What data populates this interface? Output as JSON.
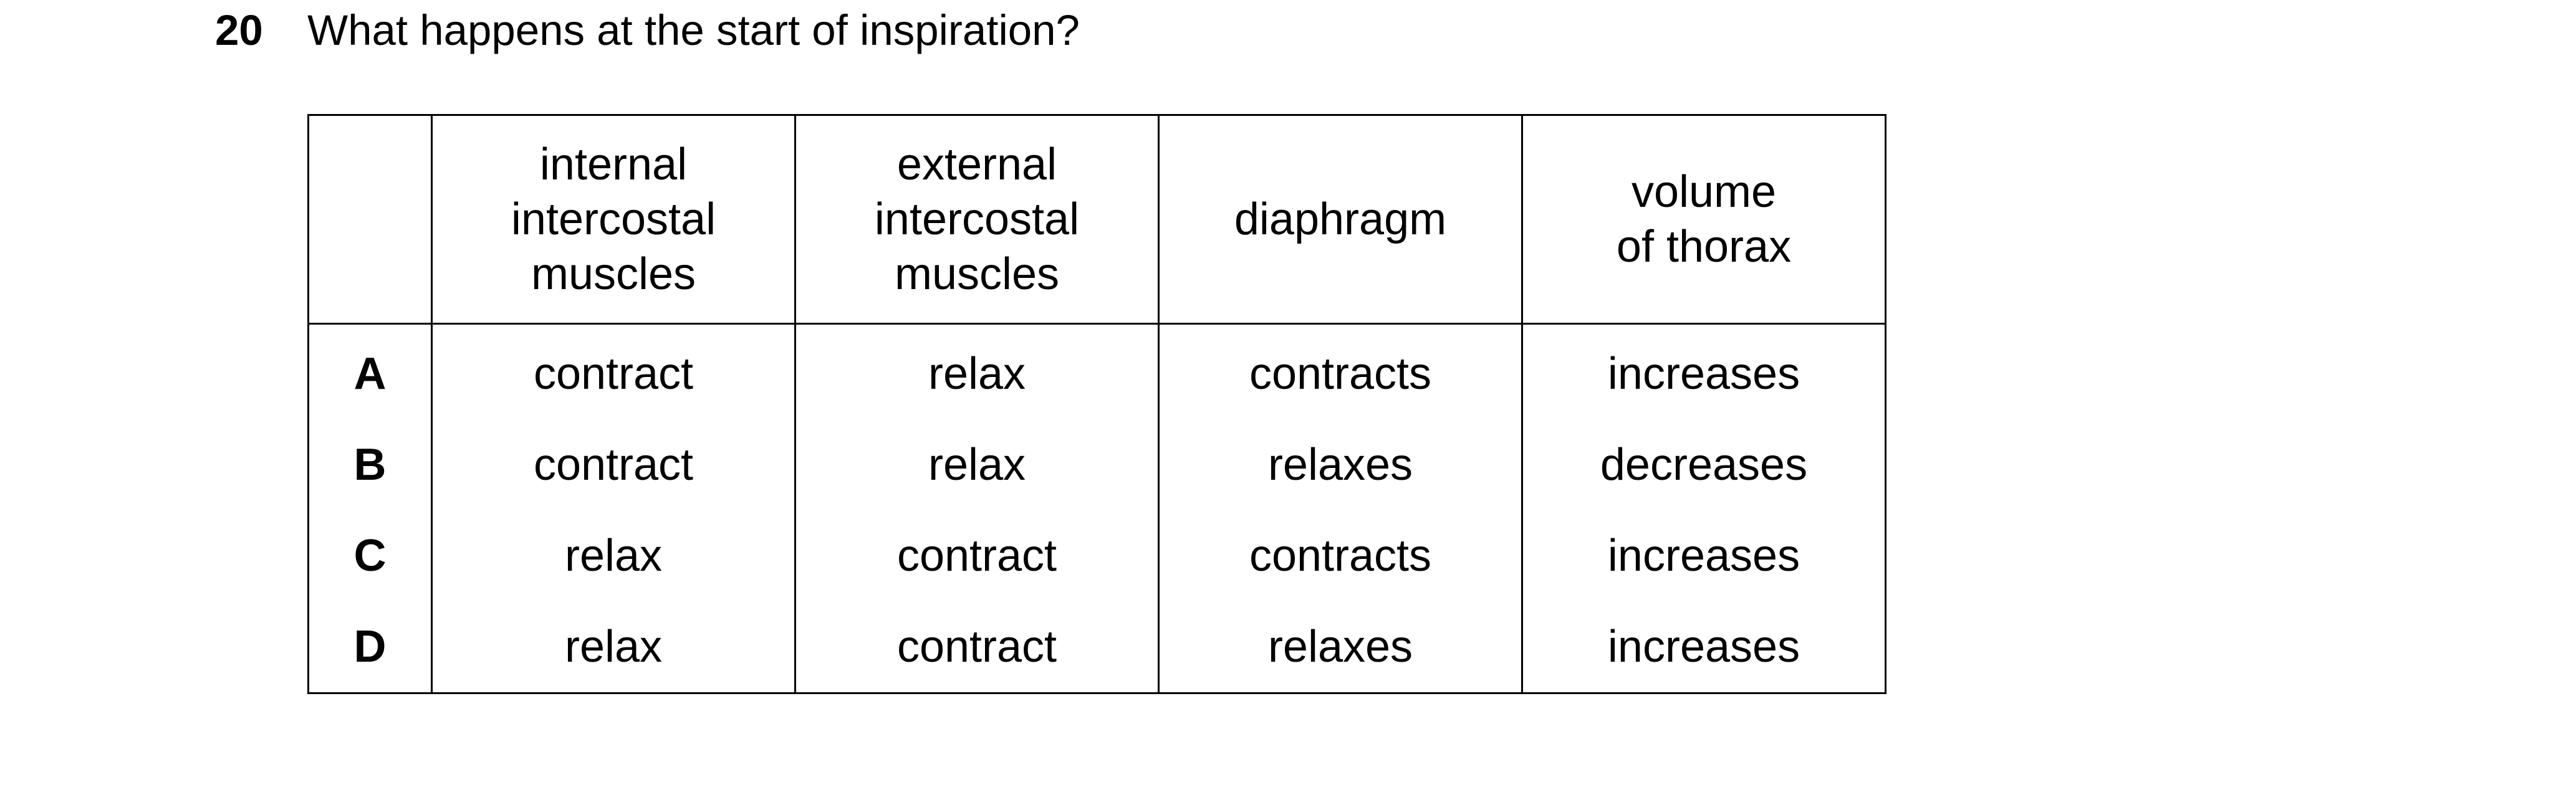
{
  "question": {
    "number": "20",
    "text": "What happens at the start of inspiration?"
  },
  "table": {
    "headers": [
      {
        "lines": [
          "internal",
          "intercostal",
          "muscles"
        ]
      },
      {
        "lines": [
          "external",
          "intercostal",
          "muscles"
        ]
      },
      {
        "lines": [
          "diaphragm"
        ]
      },
      {
        "lines": [
          "volume",
          "of thorax"
        ]
      }
    ],
    "rows": [
      {
        "letter": "A",
        "cells": [
          "contract",
          "relax",
          "contracts",
          "increases"
        ]
      },
      {
        "letter": "B",
        "cells": [
          "contract",
          "relax",
          "relaxes",
          "decreases"
        ]
      },
      {
        "letter": "C",
        "cells": [
          "relax",
          "contract",
          "contracts",
          "increases"
        ]
      },
      {
        "letter": "D",
        "cells": [
          "relax",
          "contract",
          "relaxes",
          "increases"
        ]
      }
    ]
  }
}
